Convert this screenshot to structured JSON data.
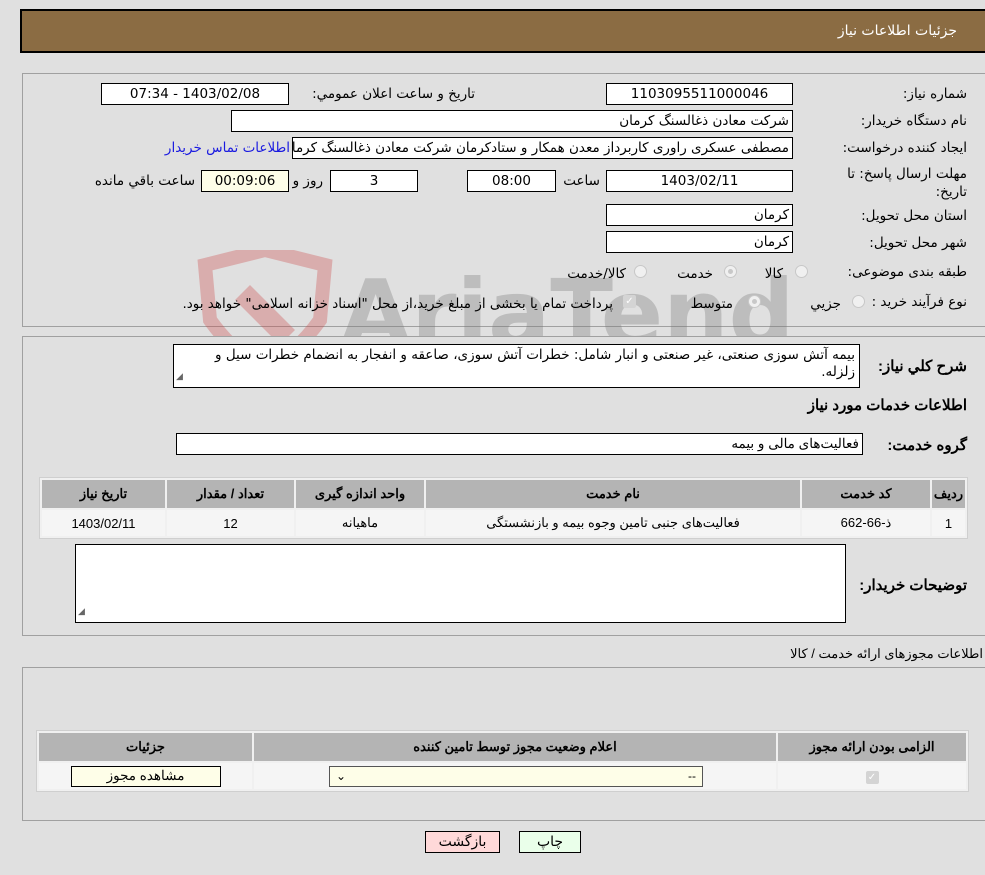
{
  "header": {
    "title": "جزئیات اطلاعات نیاز"
  },
  "form": {
    "need_number_label": "شماره نیاز:",
    "need_number": "1103095511000046",
    "announce_label": "تاریخ و ساعت اعلان عمومي:",
    "announce_value": "1403/02/08 - 07:34",
    "buyer_org_label": "نام دستگاه خریدار:",
    "buyer_org": "شرکت معادن ذغالسنگ کرمان",
    "creator_label": "ایجاد کننده درخواست:",
    "creator": "مصطفی عسکری راوری کاربرداز معدن همکار و ستادکرمان شرکت معادن ذغالسنگ کرمان",
    "buyer_contact_link": "اطلاعات تماس خریدار",
    "deadline_label": "مهلت ارسال پاسخ: تا تاریخ:",
    "deadline_date": "1403/02/11",
    "time_label": "ساعت",
    "deadline_time": "08:00",
    "days_value": "3",
    "days_label": "روز و",
    "remaining_time": "00:09:06",
    "remaining_label": "ساعت باقي مانده",
    "province_label": "استان محل تحویل:",
    "province": "کرمان",
    "city_label": "شهر محل تحویل:",
    "city": "کرمان",
    "category_label": "طبقه بندی موضوعی:",
    "category_options": [
      "کالا",
      "خدمت",
      "کالا/خدمت"
    ],
    "category_selected": "خدمت",
    "process_label": "نوع فرآیند خرید :",
    "process_options": [
      "جزيي",
      "متوسط"
    ],
    "process_selected": "متوسط",
    "treasury_note": "پرداخت تمام یا بخشی از مبلغ خرید،از محل \"اسناد خزانه اسلامی\" خواهد بود."
  },
  "description": {
    "label": "شرح کلي نیاز:",
    "text": "بیمه آتش سوزی صنعتی، غیر صنعتی و انبار شامل: خطرات آتش سوزی، صاعقه و انفجار به انضمام خطرات سیل و زلزله."
  },
  "services": {
    "section_title": "اطلاعات خدمات مورد نیاز",
    "group_label": "گروه خدمت:",
    "group_value": "فعالیت‌های مالی و بیمه",
    "columns": [
      "ردیف",
      "کد خدمت",
      "نام خدمت",
      "واحد اندازه گیری",
      "تعداد / مقدار",
      "تاریخ نیاز"
    ],
    "rows": [
      [
        "1",
        "ذ-66-662",
        "فعالیت‌های جنبی تامین وجوه بیمه و بازنشستگی",
        "ماهیانه",
        "12",
        "1403/02/11"
      ]
    ]
  },
  "buyer_notes": {
    "label": "توضیحات خریدار:",
    "value": ""
  },
  "permits": {
    "section_title": "اطلاعات مجوزهای ارائه خدمت / کالا",
    "columns": [
      "الزامی بودن ارائه مجوز",
      "اعلام وضعیت مجوز توسط تامین کننده",
      "جزئیات"
    ],
    "row": {
      "required_checked": true,
      "status_selected": "--",
      "details_button": "مشاهده مجوز"
    }
  },
  "buttons": {
    "print": "چاپ",
    "back": "بازگشت"
  },
  "watermark": {
    "text": "AriaTender.neT"
  },
  "colors": {
    "header_bg": "#8b6c43",
    "link": "#1a1ae0",
    "print_bg": "#eaffea",
    "back_bg": "#ffd9d9",
    "highlight_bg": "#fefee8"
  }
}
